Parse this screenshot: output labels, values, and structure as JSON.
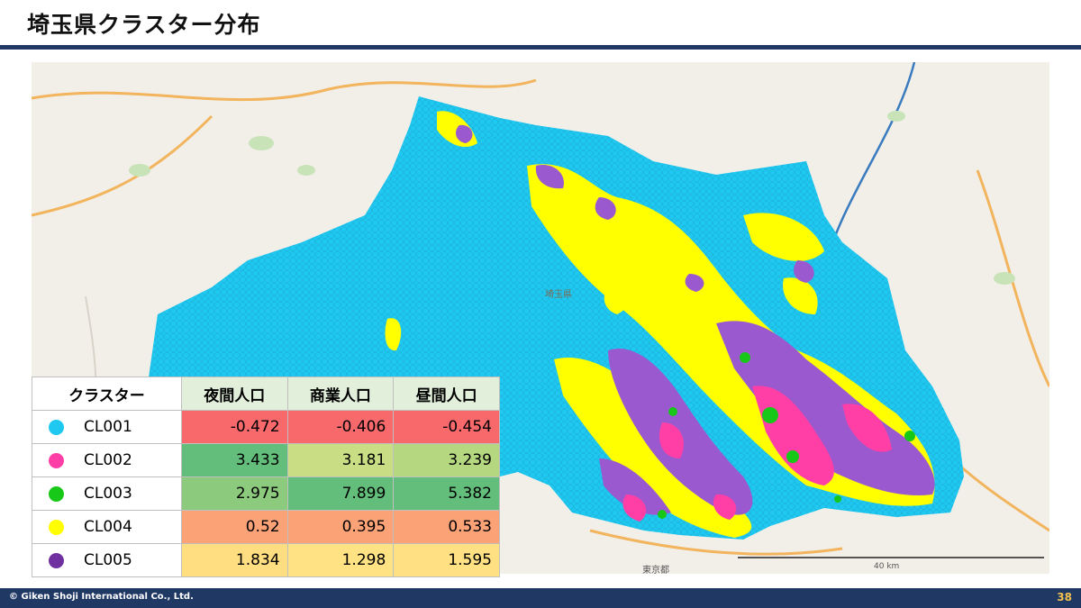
{
  "slide": {
    "title": "埼玉県クラスター分布",
    "copyright": "© Giken Shoji International Co., Ltd.",
    "page_number": "38"
  },
  "map": {
    "prefecture_label": "埼玉県",
    "city_label": "東京都",
    "scale_label": "40 km"
  },
  "table": {
    "headers": [
      "クラスター",
      "夜間人口",
      "商業人口",
      "昼間人口"
    ],
    "rows": [
      {
        "name": "CL001",
        "color": "#1ec8f0",
        "values": [
          "-0.472",
          "-0.406",
          "-0.454"
        ],
        "bg": [
          "#f8696b",
          "#f8696b",
          "#f8696b"
        ]
      },
      {
        "name": "CL002",
        "color": "#ff3fa6",
        "values": [
          "3.433",
          "3.181",
          "3.239"
        ],
        "bg": [
          "#63be7b",
          "#c9dd84",
          "#b5d780"
        ]
      },
      {
        "name": "CL003",
        "color": "#18c818",
        "values": [
          "2.975",
          "7.899",
          "5.382"
        ],
        "bg": [
          "#8cca7e",
          "#63be7b",
          "#63be7b"
        ]
      },
      {
        "name": "CL004",
        "color": "#ffff00",
        "values": [
          "0.52",
          "0.395",
          "0.533"
        ],
        "bg": [
          "#fba276",
          "#fba276",
          "#fba276"
        ]
      },
      {
        "name": "CL005",
        "color": "#7030a0",
        "values": [
          "1.834",
          "1.298",
          "1.595"
        ],
        "bg": [
          "#ffdd81",
          "#ffe283",
          "#ffe083"
        ]
      }
    ]
  }
}
